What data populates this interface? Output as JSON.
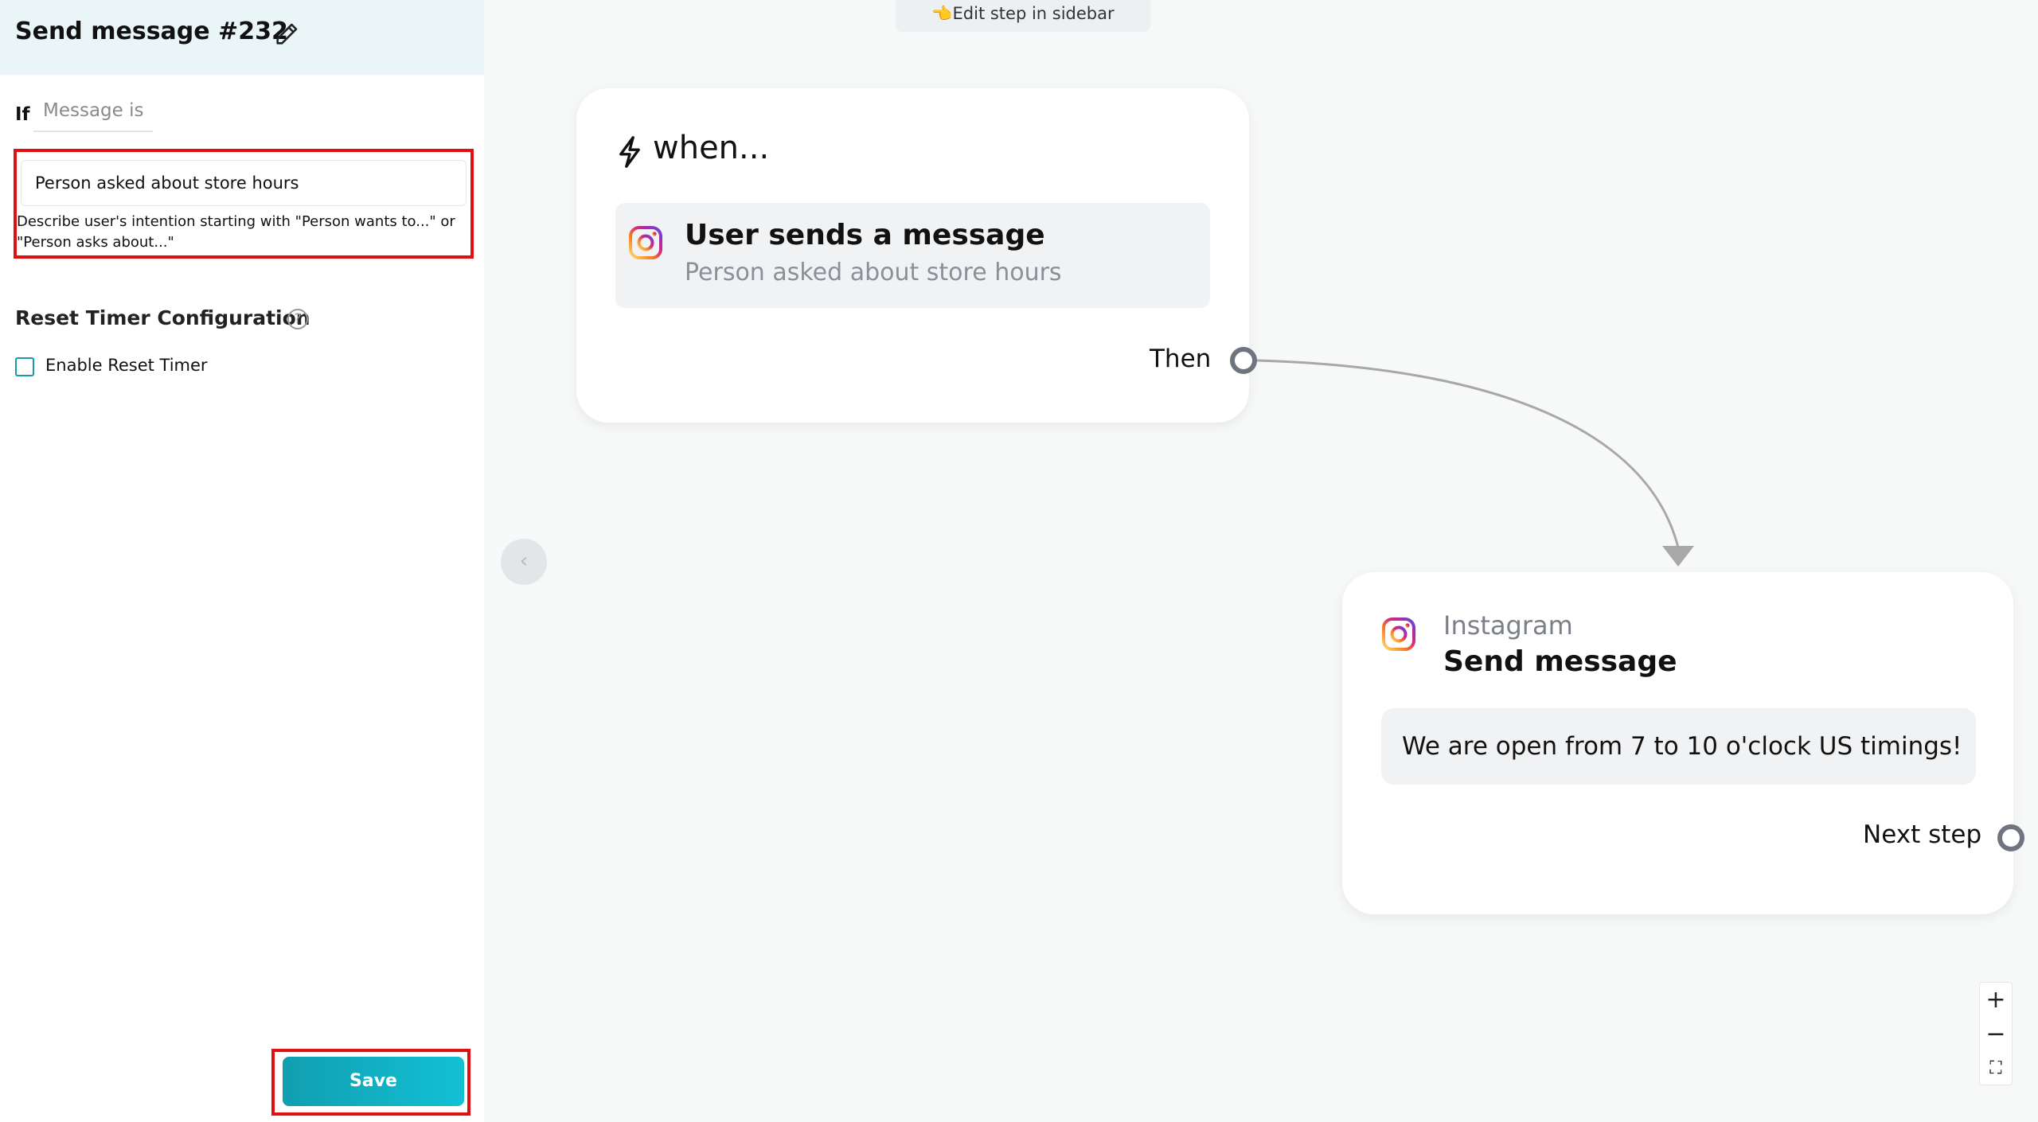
{
  "sidebar": {
    "title": "Send message #232",
    "if_label": "If",
    "condition_select": "Message is",
    "intent_value": "Person asked about store hours",
    "intent_help": "Describe user's intention starting with \"Person wants to...\" or \"Person asks about...\"",
    "reset_title": "Reset Timer Configuration",
    "help_glyph": "?",
    "reset_checkbox_label": "Enable Reset Timer",
    "reset_checked": false,
    "save_label": "Save"
  },
  "canvas": {
    "edit_hint": "👈Edit step in sidebar",
    "collapse_glyph": "‹",
    "trigger": {
      "heading": "when...",
      "title": "User sends a message",
      "subtitle": "Person asked about store hours",
      "then_label": "Then"
    },
    "action": {
      "provider": "Instagram",
      "title": "Send message",
      "message": "We are open from 7 to 10 o'clock US timings!",
      "next_label": "Next step"
    },
    "zoom": {
      "zoom_in": "+",
      "zoom_out": "−",
      "fit": "⛶"
    }
  },
  "icons": {
    "edit": "pencil-icon",
    "bolt": "lightning-bolt-icon",
    "instagram": "instagram-icon",
    "help": "question-circle-icon",
    "collapse": "chevron-left-icon",
    "fit": "fit-view-icon"
  },
  "colors": {
    "accent": "#12b3c4",
    "highlight": "#e01010",
    "port": "#6f7480",
    "connector": "#a8a8a8"
  }
}
